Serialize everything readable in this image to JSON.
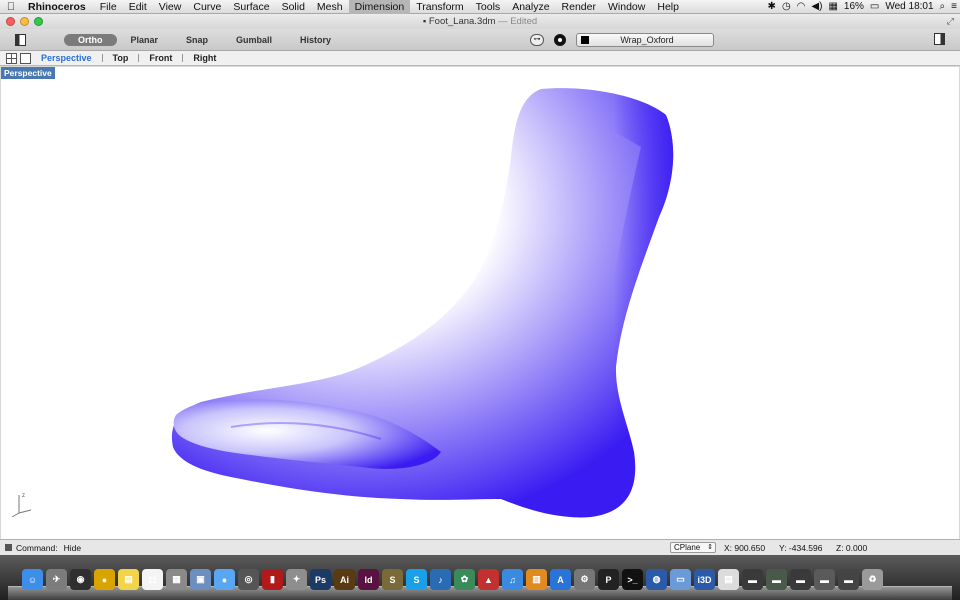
{
  "menubar": {
    "app_name": "Rhinoceros",
    "menus": [
      "File",
      "Edit",
      "View",
      "Curve",
      "Surface",
      "Solid",
      "Mesh",
      "Dimension",
      "Transform",
      "Tools",
      "Analyze",
      "Render",
      "Window",
      "Help"
    ],
    "active_menu": "Dimension",
    "battery": "16%",
    "clock": "Wed 18:01"
  },
  "window": {
    "filename": "Foot_Lana.3dm",
    "separator": "—",
    "state": "Edited",
    "traffic_colors": [
      "#fc605c",
      "#fdbc40",
      "#34c84a"
    ]
  },
  "toolbar": {
    "toggles": [
      "Ortho",
      "Planar",
      "Snap",
      "Gumball",
      "History"
    ],
    "active_toggle": "Ortho",
    "layer_name": "Wrap_Oxford",
    "layer_color": "#000000"
  },
  "viewport_tabs": {
    "tabs": [
      "Perspective",
      "Top",
      "Front",
      "Right"
    ],
    "active_tab": "Perspective"
  },
  "viewport": {
    "label": "Perspective",
    "object_color": "#3a1cf2",
    "highlight_color": "#ffffff",
    "axis_z": "z"
  },
  "statusbar": {
    "command_prompt": "Command:",
    "command_value": "Hide",
    "cplane_label": "CPlane",
    "x": "X: 900.650",
    "y": "Y: -434.596",
    "z": "Z: 0.000"
  },
  "dock": {
    "icons": [
      {
        "name": "finder-icon",
        "glyph": "☺",
        "color": "#3d8ee8"
      },
      {
        "name": "launchpad-icon",
        "glyph": "✈",
        "color": "#7c7c7c"
      },
      {
        "name": "dashboard-icon",
        "glyph": "◉",
        "color": "#2f2f2f"
      },
      {
        "name": "chrome-icon",
        "glyph": "●",
        "color": "#d9a400"
      },
      {
        "name": "stickies-icon",
        "glyph": "▤",
        "color": "#f2d44a"
      },
      {
        "name": "calendar-icon",
        "glyph": "11",
        "color": "#f4f4f4"
      },
      {
        "name": "calculator-icon",
        "glyph": "▦",
        "color": "#8a8a8a"
      },
      {
        "name": "preview-icon",
        "glyph": "▣",
        "color": "#6c8fbf"
      },
      {
        "name": "messages-icon",
        "glyph": "●",
        "color": "#59a6f2"
      },
      {
        "name": "camera-icon",
        "glyph": "◎",
        "color": "#555555"
      },
      {
        "name": "photo-booth-icon",
        "glyph": "▮",
        "color": "#b01a1a"
      },
      {
        "name": "tools-icon",
        "glyph": "✦",
        "color": "#8e8e8e"
      },
      {
        "name": "photoshop-icon",
        "glyph": "Ps",
        "color": "#1c3a66"
      },
      {
        "name": "illustrator-icon",
        "glyph": "Ai",
        "color": "#5a3a12"
      },
      {
        "name": "indesign-icon",
        "glyph": "Id",
        "color": "#5a1240"
      },
      {
        "name": "sketch-icon",
        "glyph": "S",
        "color": "#7a6a3a"
      },
      {
        "name": "skype-icon",
        "glyph": "S",
        "color": "#1aa0e8"
      },
      {
        "name": "music-app-icon",
        "glyph": "♪",
        "color": "#2a6cb3"
      },
      {
        "name": "photos-icon",
        "glyph": "✿",
        "color": "#3a8a5a"
      },
      {
        "name": "rhino-icon",
        "glyph": "▲",
        "color": "#c23030"
      },
      {
        "name": "itunes-icon",
        "glyph": "♫",
        "color": "#3a8ae0"
      },
      {
        "name": "ibooks-icon",
        "glyph": "▥",
        "color": "#e08a20"
      },
      {
        "name": "app-store-icon",
        "glyph": "A",
        "color": "#2a74d8"
      },
      {
        "name": "system-preferences-icon",
        "glyph": "⚙",
        "color": "#777777"
      },
      {
        "name": "pages-icon",
        "glyph": "P",
        "color": "#222222"
      },
      {
        "name": "terminal-icon",
        "glyph": ">_",
        "color": "#111111"
      },
      {
        "name": "network-icon",
        "glyph": "◍",
        "color": "#2a5aa8"
      },
      {
        "name": "folder-icon",
        "glyph": "▭",
        "color": "#6a9ad8"
      },
      {
        "name": "3d-app-icon",
        "glyph": "i3D",
        "color": "#2a5aa8"
      },
      {
        "name": "document-icon",
        "glyph": "▤",
        "color": "#dcdcdc"
      },
      {
        "name": "window-thumb-icon",
        "glyph": "▬",
        "color": "#3a3a3a"
      },
      {
        "name": "window-thumb-icon",
        "glyph": "▬",
        "color": "#4a5a4a"
      },
      {
        "name": "window-thumb-icon",
        "glyph": "▬",
        "color": "#3a3a3a"
      },
      {
        "name": "window-thumb-icon",
        "glyph": "▬",
        "color": "#5a5a5a"
      },
      {
        "name": "window-thumb-icon",
        "glyph": "▬",
        "color": "#444444"
      },
      {
        "name": "trash-icon",
        "glyph": "♻",
        "color": "#9a9a9a"
      }
    ]
  }
}
